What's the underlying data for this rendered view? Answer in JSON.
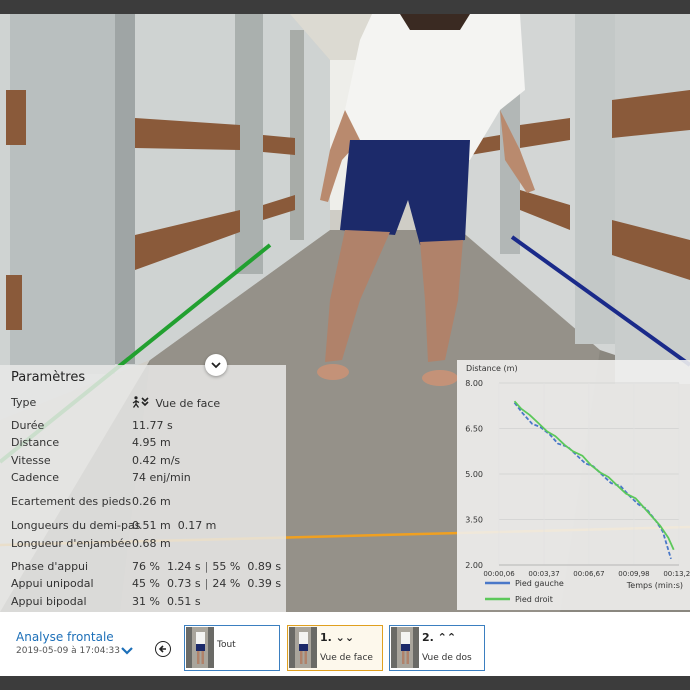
{
  "params": {
    "title": "Paramètres",
    "rows": [
      {
        "label": "Type",
        "value": "Vue de face"
      },
      {
        "label": "Durée",
        "value": "11.77 s"
      },
      {
        "label": "Distance",
        "value": "4.95 m"
      },
      {
        "label": "Vitesse",
        "value": "0.42 m/s"
      },
      {
        "label": "Cadence",
        "value": "74 enj/min"
      },
      {
        "label": "Ecartement des pieds",
        "value": "0.26 m"
      },
      {
        "label": "Longueurs du demi-pas",
        "value": "0.51 m  0.17 m"
      },
      {
        "label": "Longueur d'enjambée",
        "value": "0.68 m"
      },
      {
        "label": "Phase d'appui",
        "value_a": "76 %  1.24 s",
        "value_b": "55 %  0.89 s"
      },
      {
        "label": "Appui unipodal",
        "value_a": "45 %  0.73 s",
        "value_b": "24 %  0.39 s"
      },
      {
        "label": "Appui bipodal",
        "value": "31 %  0.51 s"
      }
    ]
  },
  "chart_data": {
    "type": "line",
    "ylabel": "Distance (m)",
    "xlabel": "Temps (min:s)",
    "x_ticks": [
      "00:00,06",
      "00:03,37",
      "00:06,67",
      "00:09,98",
      "00:13,29"
    ],
    "y_ticks": [
      "2.00",
      "3.50",
      "5.00",
      "6.50",
      "8.00"
    ],
    "xlim_seconds": [
      0.06,
      13.29
    ],
    "ylim": [
      2.0,
      8.0
    ],
    "series": [
      {
        "name": "Pied gauche",
        "color": "#4a78c8",
        "dashed": true,
        "x": [
          1.2,
          1.8,
          2.5,
          3.1,
          3.8,
          4.4,
          5.1,
          5.7,
          6.4,
          7.0,
          7.7,
          8.3,
          9.0,
          9.6,
          10.3,
          10.9,
          11.6,
          12.1,
          12.7
        ],
        "y": [
          7.35,
          7.0,
          6.65,
          6.55,
          6.3,
          6.0,
          5.9,
          5.65,
          5.35,
          5.25,
          4.95,
          4.7,
          4.6,
          4.3,
          4.0,
          3.85,
          3.45,
          3.1,
          2.2
        ]
      },
      {
        "name": "Pied droit",
        "color": "#5cc85a",
        "dashed": false,
        "x": [
          1.2,
          1.7,
          2.3,
          2.9,
          3.6,
          4.2,
          4.9,
          5.5,
          6.2,
          6.8,
          7.5,
          8.1,
          8.8,
          9.4,
          10.1,
          10.7,
          11.3,
          11.9,
          12.5,
          12.9
        ],
        "y": [
          7.4,
          7.15,
          6.95,
          6.7,
          6.4,
          6.25,
          5.95,
          5.75,
          5.6,
          5.3,
          5.05,
          4.9,
          4.6,
          4.35,
          4.2,
          3.9,
          3.6,
          3.3,
          2.9,
          2.5
        ]
      }
    ]
  },
  "toolbar": {
    "title": "Analyse frontale",
    "date": "2019-05-09 à 17:04:33",
    "thumbs": [
      {
        "num": "",
        "label": "Tout"
      },
      {
        "num": "1. ⌄⌄",
        "label": "Vue de face"
      },
      {
        "num": "2. ⌃⌃",
        "label": "Vue de dos"
      }
    ]
  },
  "colors": {
    "accent": "#1c6fb8",
    "active_thumb": "#e0a020",
    "left_foot": "#4a78c8",
    "right_foot": "#5cc85a",
    "orange_line": "#f0a020",
    "green_line": "#22a030",
    "navy_line": "#1a2a8a"
  }
}
